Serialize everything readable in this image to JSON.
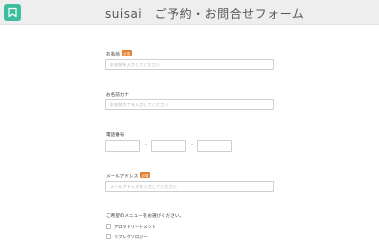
{
  "header": {
    "title": "suisai　ご予約・お問合せフォーム",
    "logo_icon": "bookmark-icon"
  },
  "form": {
    "required_badge": "必須",
    "name": {
      "label": "お名前",
      "placeholder": "お名前を入力してください",
      "value": ""
    },
    "name_kana": {
      "label": "お名前カナ",
      "placeholder": "お名前カナを入力してください",
      "value": ""
    },
    "phone": {
      "label": "電話番号",
      "separator": "-",
      "parts": [
        "",
        "",
        ""
      ]
    },
    "email": {
      "label": "メールアドレス",
      "placeholder": "メールアドレスを入力してください",
      "value": ""
    },
    "menu": {
      "label": "ご希望のメニューをお選びください。",
      "options": [
        {
          "label": "アロマトリートメント",
          "checked": false
        },
        {
          "label": "リフレクソロジー",
          "checked": false
        }
      ]
    }
  }
}
